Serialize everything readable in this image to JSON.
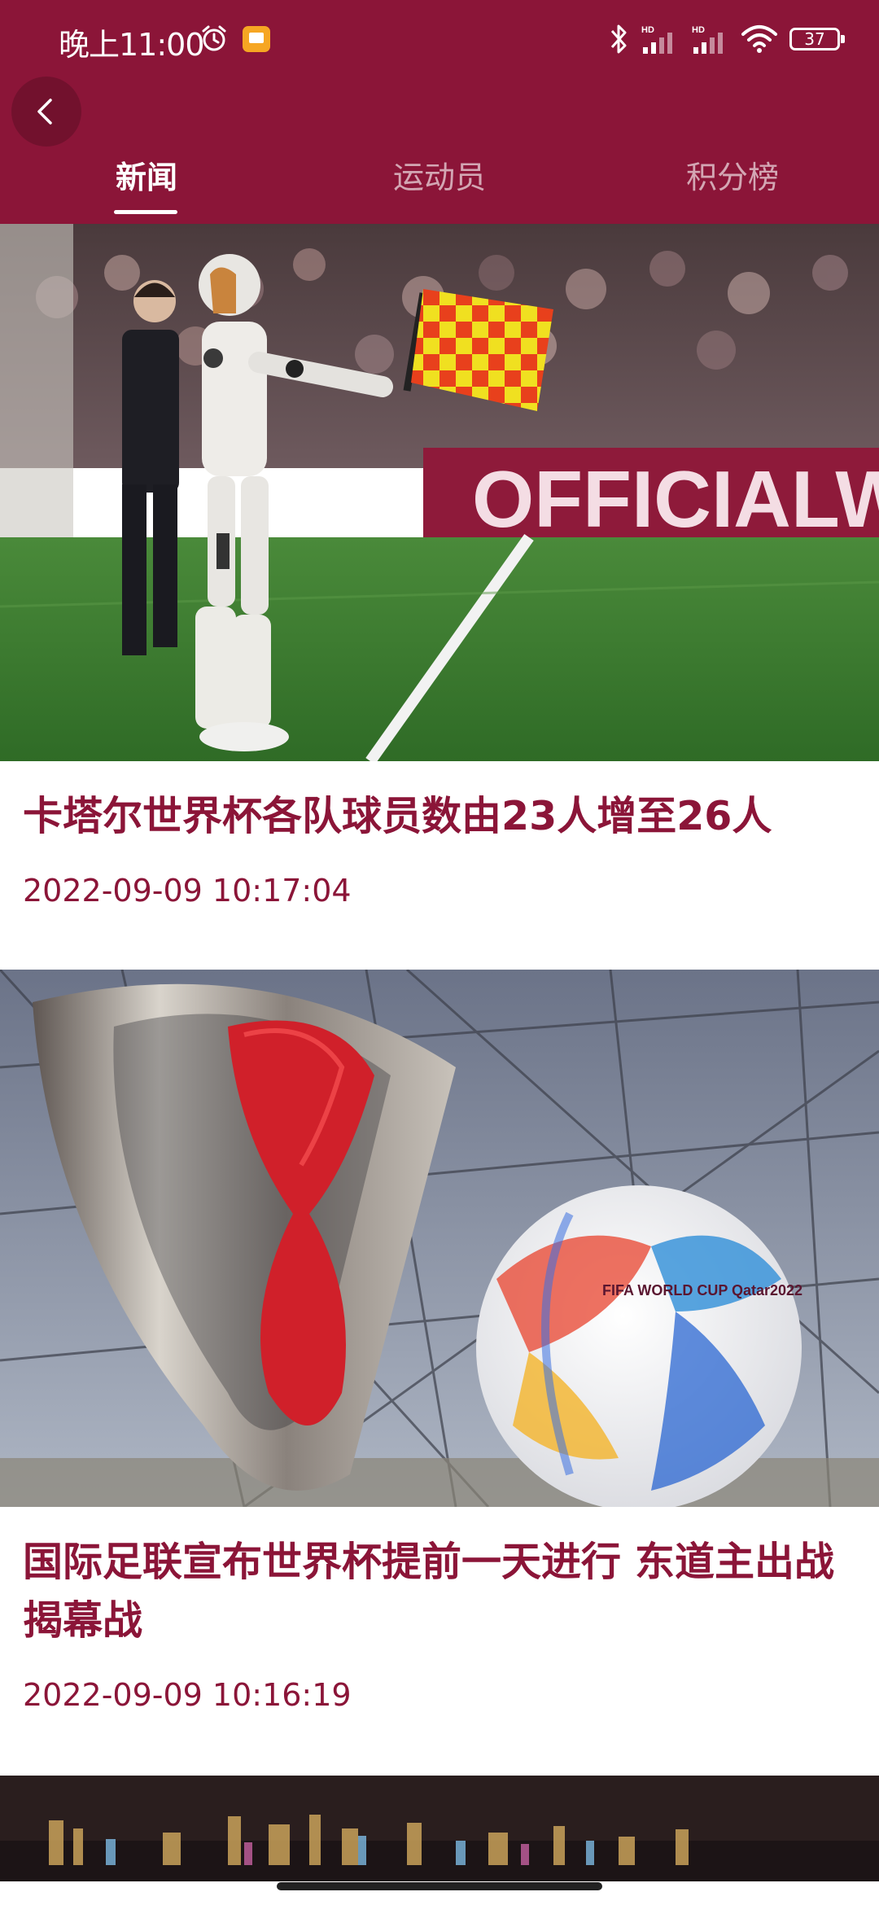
{
  "status_bar": {
    "time": "晚上11:00",
    "battery": "37",
    "icons": [
      "alarm-icon",
      "notification-icon",
      "bluetooth-icon",
      "signal-hd-icon",
      "signal-hd-icon",
      "wifi-icon",
      "battery-icon"
    ]
  },
  "header": {
    "back_icon": "chevron-left-icon",
    "background_color": "#8b1538",
    "tabs": [
      {
        "label": "新闻",
        "active": true
      },
      {
        "label": "运动员",
        "active": false
      },
      {
        "label": "积分榜",
        "active": false
      }
    ]
  },
  "news": [
    {
      "title": "卡塔尔世界杯各队球员数由23人增至26人",
      "time": "2022-09-09 10:17:04"
    },
    {
      "title": "国际足联宣布世界杯提前一天进行 东道主出战揭幕战",
      "time": "2022-09-09 10:16:19"
    },
    {
      "title": "",
      "time": ""
    }
  ],
  "image_text": {
    "banner": "OFFICIALW",
    "ball": "FIFA WORLD CUP Qatar2022"
  },
  "colors": {
    "accent": "#8b1538",
    "text_on_accent": "#ffffff"
  }
}
